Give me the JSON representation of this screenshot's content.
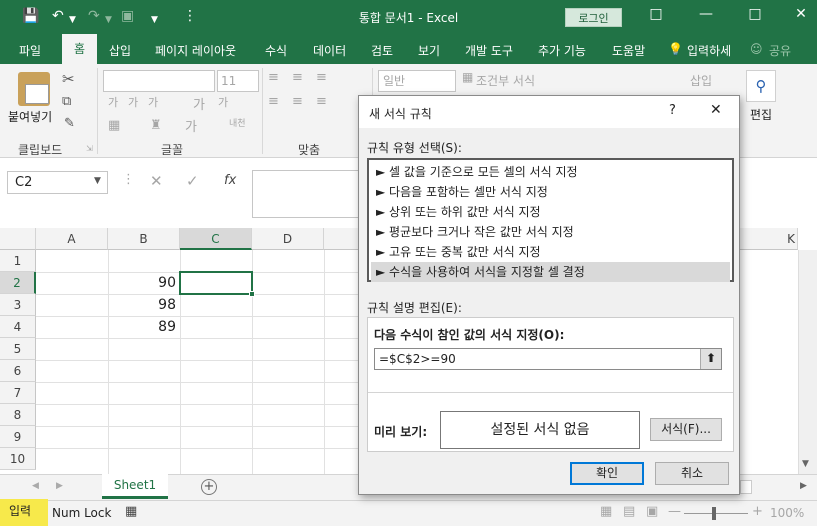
{
  "window": {
    "title": "통합 문서1  -  Excel",
    "login_label": "로그인"
  },
  "ribbon_tabs": [
    "파일",
    "홈",
    "삽입",
    "페이지 레이아웃",
    "수식",
    "데이터",
    "검토",
    "보기",
    "개발 도구",
    "추가 기능",
    "도움말",
    "입력하세",
    "공유"
  ],
  "ribbon": {
    "paste_label": "붙여넣기",
    "clipboard_label": "클립보드",
    "font_label": "글꼴",
    "font_size": "11",
    "align_label": "맞춤",
    "number_format": "일반",
    "conditional_label": "조건부 서식",
    "insert_label": "삽입",
    "edit_label": "편집",
    "font_chars": [
      "가",
      "가",
      "가",
      "가",
      "가",
      "가",
      "내천"
    ]
  },
  "formula_bar": {
    "name_box": "C2",
    "fx": "fx"
  },
  "sheet": {
    "columns": [
      "A",
      "B",
      "C",
      "D",
      "K"
    ],
    "rows": [
      "1",
      "2",
      "3",
      "4",
      "5",
      "6",
      "7",
      "8",
      "9",
      "10"
    ],
    "values": {
      "B2": "90",
      "B3": "98",
      "B4": "89"
    },
    "active_cell": "C2"
  },
  "sheet_tabs": {
    "active": "Sheet1"
  },
  "status": {
    "mode": "입력",
    "num_lock": "Num Lock",
    "zoom": "100%"
  },
  "dialog": {
    "title": "새 서식 규칙",
    "help": "?",
    "rule_type_label": "규칙 유형 선택(S):",
    "rule_types": [
      "► 셀 값을 기준으로 모든 셀의 서식 지정",
      "► 다음을 포함하는 셀만 서식 지정",
      "► 상위 또는 하위 값만 서식 지정",
      "► 평균보다 크거나 작은 값만 서식 지정",
      "► 고유 또는 중복 값만 서식 지정",
      "► 수식을 사용하여 서식을 지정할 셀 결정"
    ],
    "selected_index": 5,
    "rule_desc_label": "규칙 설명 편집(E):",
    "formula_label": "다음 수식이 참인 값의 서식 지정(O):",
    "formula_value": "=$C$2>=90",
    "preview_label": "미리 보기:",
    "preview_text": "설정된 서식 없음",
    "format_button": "서식(F)...",
    "ok_button": "확인",
    "cancel_button": "취소"
  },
  "colors": {
    "excel_green": "#217346",
    "selection": "#d9d9d9",
    "status_highlight": "#f7e94b"
  }
}
